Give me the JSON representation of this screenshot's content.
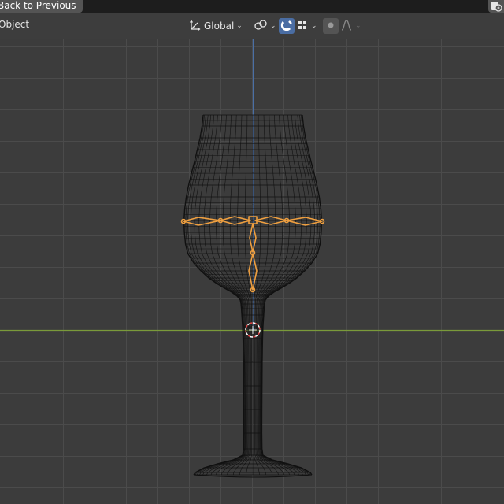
{
  "topbar": {
    "back_button_label": "Back to Previous",
    "corner_icon": "file-icon"
  },
  "header": {
    "mode_label": "Object",
    "transform_orientation": {
      "icon": "orientation-axes-icon",
      "value": "Global"
    },
    "pivot_point_icon": "pivot-point-icon",
    "snap_toggle_icon": "magnet-icon",
    "snap_target_icon": "snap-increment-icon",
    "proportional_editing_icon": "proportional-editing-icon",
    "falloff_icon": "smooth-falloff-icon"
  },
  "viewport": {
    "background_color": "#3c3c3c",
    "grid_color": "#4d4d4d",
    "x_axis_color": "#7a9a3a",
    "z_axis_color": "#4a6fa5",
    "mesh_color": "#111111",
    "armature_color": "#f0a040",
    "object": "wine-glass-wireframe",
    "armature": "orange-bone-rig",
    "origin_marker": "3d-cursor"
  }
}
